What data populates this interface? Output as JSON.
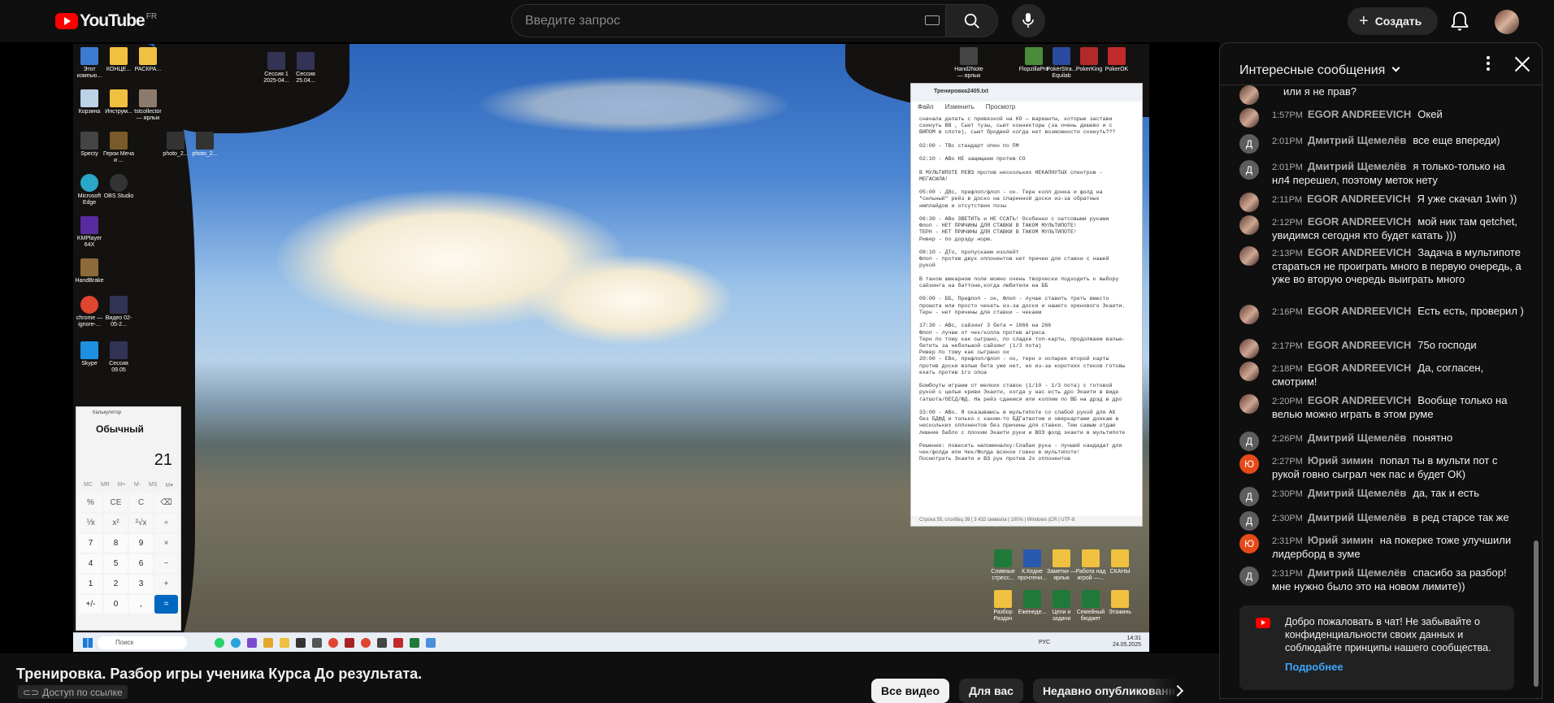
{
  "masthead": {
    "logo_text": "YouTube",
    "country_code": "FR",
    "search_placeholder": "Введите запрос",
    "create_label": "Создать"
  },
  "video": {
    "title": "Тренировка. Разбор игры ученика Курса До результата.",
    "access_badge": "Доступ по ссылке",
    "desktop_icons": [
      {
        "label": "Этот компью..."
      },
      {
        "label": "КОНЦЕ..."
      },
      {
        "label": "РАСКРА..."
      },
      {
        "label": "Корзина"
      },
      {
        "label": "Инструм..."
      },
      {
        "label": "tstcollector — ярлык"
      },
      {
        "label": "Specty"
      },
      {
        "label": "Герои Меча и ..."
      },
      {
        "label": "photo_2..."
      },
      {
        "label": "photo_2..."
      },
      {
        "label": "Microsoft Edge"
      },
      {
        "label": "OBS Studio"
      },
      {
        "label": "KMPlayer 64X"
      },
      {
        "label": "HandBrake"
      },
      {
        "label": "chrome — ignore-..."
      },
      {
        "label": "Видео 02-05-2..."
      },
      {
        "label": "Skype"
      },
      {
        "label": "Сессия 09.05"
      },
      {
        "label": "Сессия 1 2025-04..."
      },
      {
        "label": "Сессия 25.04..."
      },
      {
        "label": "Hand2Note — ярлык"
      },
      {
        "label": "FlopzillaPro"
      },
      {
        "label": "PokerStra... Equilab"
      },
      {
        "label": "PokerKing"
      },
      {
        "label": "PokerOK"
      },
      {
        "label": "Сливные стресс..."
      },
      {
        "label": "К.Кедне прочтени..."
      },
      {
        "label": "Заметки — ярлык"
      },
      {
        "label": "Работа над игрой —..."
      },
      {
        "label": "СКАНЫ"
      },
      {
        "label": "Разбор Раздач"
      },
      {
        "label": "Еженеде..."
      },
      {
        "label": "Цели и задачи"
      },
      {
        "label": "Семейный бюджет"
      },
      {
        "label": "Этажинь"
      }
    ],
    "notepad": {
      "title": "Тренировка2405.txt",
      "menu": [
        "Файл",
        "Изменить",
        "Просмотр"
      ],
      "text": "сначала делать с привязкой на КО — варианты, которые застави\nскинуть ВВ , Сьют тузы, сьют коннекторы (за очень дешево и с\nВИПОМ в споте), сьют бродвей когда нет возможности скинуть???\n\n02:00 - ТВс стандарт опен по ПМ\n\n02:10 - АВо НЕ защищаем против СО\n\nВ МУЛЬТИПОТЕ РЕЙЗ против нескольких НЕКАПНУТЫХ спектров -\nМЕГАСИЛА!\n\n05:00 - ДВс, префлоп/флоп - ок. Терн колл донка и фолд на\n\"сильный\" рейз в доско на спаренной доски из-за обратных\nимплайдов и отсутствия позы\n\n06:30 - АВо ЗВЕТИТЬ и НЕ ССАТЬ! Особенно с оатсовыми руками\nФлоп - НЕТ ПРИЧИНЫ ДЛЯ СТАВКИ В ТАКОМ МУЛЬТИПОТЕ!\nТЕРН - НЕТ ПРИЧИНЫ ДЛЯ СТАВКИ В ТАКОМ МУЛЬТИПОТЕ!\nРивер - по дорэду норм.\n\n08:10 - ДТо, пропускаем изолейт\nФлоп - против двух оппонентов нет причин для ставки с нашей\nрукой\n\nВ таком шмкарном поле можно очень творчески подходить к выбору\nсайзинга на баттоне,когда любители на ББ\n\n09:00 - ББ, Префлоп - ок, Флоп - лучше ставить треть вместо\nпрошота или просто чекать из-за доски и нашего хренового Экаити.\nТерн - нет причины для ставки - чекаем\n\n17:30 - АВс, сайзинг 3 бета = 1066 на 266\nФлоп - лучше от чек/колла против агриса\nТерн по тому как сыграно, по сладке топ-карты, продолжаем вэлью-\nбетить за небольшой сайзинг (1/3 пота)\nРивер по тому как сыграно ок\n20:00 - ЕВо, префлоп/флоп - ок, терн о оспарке второй карты\nпротив доски вэлью бета уже нет, но из-за коротких стеков готовы\nехать против 1го опоа\n\nБомбоуты играем от мелких ставок (1/10 - 1/3 пота) с готовой\nрукой с целью криви Экаити, когда у нас есть дро Экаити в виде\nгатшота/ОЕСД/ФД. На рейз сдаемся или коллим по ВБ на дрэд в дро\n\n33:00 - АВо. Я оказываюсь в мультипоте со слабой рукой для АХ\nбез БДФД и только с каким-то БДГатшотом и оверкартами донкаю в\nнескольких оппонентов без причины для ставки. Тем самым отдаю\nлишние бабло с плохим Экаити руки и ВОЗ фолд экаити в мультипоте\n\nРешение: повесить напоминалку:Слабая рука - лучший кандидат для\nчек/фолда или Чек/Фолда всякое говно в мультипоте!\nПосмотреть Экаити и ВЗ рук против 2х оппонентов",
      "status": "Строка 55, столбец 39 | 3 432 символа | 100% | Windows (CR | UTF-8"
    },
    "calculator": {
      "app_name": "Калькулятор",
      "mode": "Обычный",
      "display": "21",
      "memory": [
        "MC",
        "MR",
        "M+",
        "M-",
        "MS",
        "M▾"
      ],
      "keys": [
        "%",
        "CE",
        "C",
        "⌫",
        "⅟x",
        "x²",
        "²√x",
        "÷",
        "7",
        "8",
        "9",
        "×",
        "4",
        "5",
        "6",
        "−",
        "1",
        "2",
        "3",
        "+",
        "+/-",
        "0",
        ",",
        "="
      ]
    },
    "taskbar": {
      "search": "Поиск",
      "lang": "РУС",
      "time": "14:31",
      "date": "24.05.2025"
    }
  },
  "chips": [
    "Все видео",
    "Для вас",
    "Недавно опубликованные"
  ],
  "chat": {
    "header": "Интересные сообщения",
    "messages": [
      {
        "avatar": "photo",
        "initial": "",
        "time": "",
        "author": "",
        "text": "или я не прав?"
      },
      {
        "avatar": "photo",
        "initial": "",
        "time": "1:57PM",
        "author": "EGOR ANDREEVICH",
        "text": "Окей"
      },
      {
        "avatar": "d",
        "initial": "Д",
        "time": "2:01PM",
        "author": "Дмитрий Щемелёв",
        "text": "все еще впереди)"
      },
      {
        "avatar": "d",
        "initial": "Д",
        "time": "2:01PM",
        "author": "Дмитрий Щемелёв",
        "text": "я только-только на нл4 перешел, поэтому меток нету"
      },
      {
        "avatar": "photo",
        "initial": "",
        "time": "2:11PM",
        "author": "EGOR ANDREEVICH",
        "text": "Я уже скачал 1win ))"
      },
      {
        "avatar": "photo",
        "initial": "",
        "time": "2:12PM",
        "author": "EGOR ANDREEVICH",
        "text": "мой ник там qetchet, увидимся сегодня кто будет катать )))"
      },
      {
        "avatar": "photo",
        "initial": "",
        "time": "2:13PM",
        "author": "EGOR ANDREEVICH",
        "text": "Задача в мультипоте стараться не проиграть много в первую очередь, а уже во вторую очередь выиграть много"
      },
      {
        "avatar": "photo",
        "initial": "",
        "time": "2:16PM",
        "author": "EGOR ANDREEVICH",
        "text": "Есть есть, проверил )"
      },
      {
        "avatar": "photo",
        "initial": "",
        "time": "2:17PM",
        "author": "EGOR ANDREEVICH",
        "text": "75о господи"
      },
      {
        "avatar": "photo",
        "initial": "",
        "time": "2:18PM",
        "author": "EGOR ANDREEVICH",
        "text": "Да, согласен, смотрим!"
      },
      {
        "avatar": "photo",
        "initial": "",
        "time": "2:20PM",
        "author": "EGOR ANDREEVICH",
        "text": "Вообще только на велью можно играть в этом руме"
      },
      {
        "avatar": "d",
        "initial": "Д",
        "time": "2:26PM",
        "author": "Дмитрий Щемелёв",
        "text": "понятно"
      },
      {
        "avatar": "yu",
        "initial": "Ю",
        "time": "2:27PM",
        "author": "Юрий зимин",
        "text": "попал ты в мульти пот с рукой говно сыграл чек пас и будет ОК)"
      },
      {
        "avatar": "d",
        "initial": "Д",
        "time": "2:30PM",
        "author": "Дмитрий Щемелёв",
        "text": "да, так и есть"
      },
      {
        "avatar": "d",
        "initial": "Д",
        "time": "2:30PM",
        "author": "Дмитрий Щемелёв",
        "text": "в ред старсе так же"
      },
      {
        "avatar": "yu",
        "initial": "Ю",
        "time": "2:31PM",
        "author": "Юрий зимин",
        "text": "на покерке тоже улучшили лидерборд в зуме"
      },
      {
        "avatar": "d",
        "initial": "Д",
        "time": "2:31PM",
        "author": "Дмитрий Щемелёв",
        "text": "спасибо за разбор! мне нужно было это на новом лимите))"
      }
    ],
    "welcome": "Добро пожаловать в чат! Не забывайте о конфиденциальности своих данных и соблюдайте принципы нашего сообщества.",
    "learn_more": "Подробнее"
  },
  "colors": {
    "bg": "#0f0f0f",
    "accent": "#ff0000",
    "link": "#3ea6ff",
    "calc_equals": "#0067c0"
  }
}
